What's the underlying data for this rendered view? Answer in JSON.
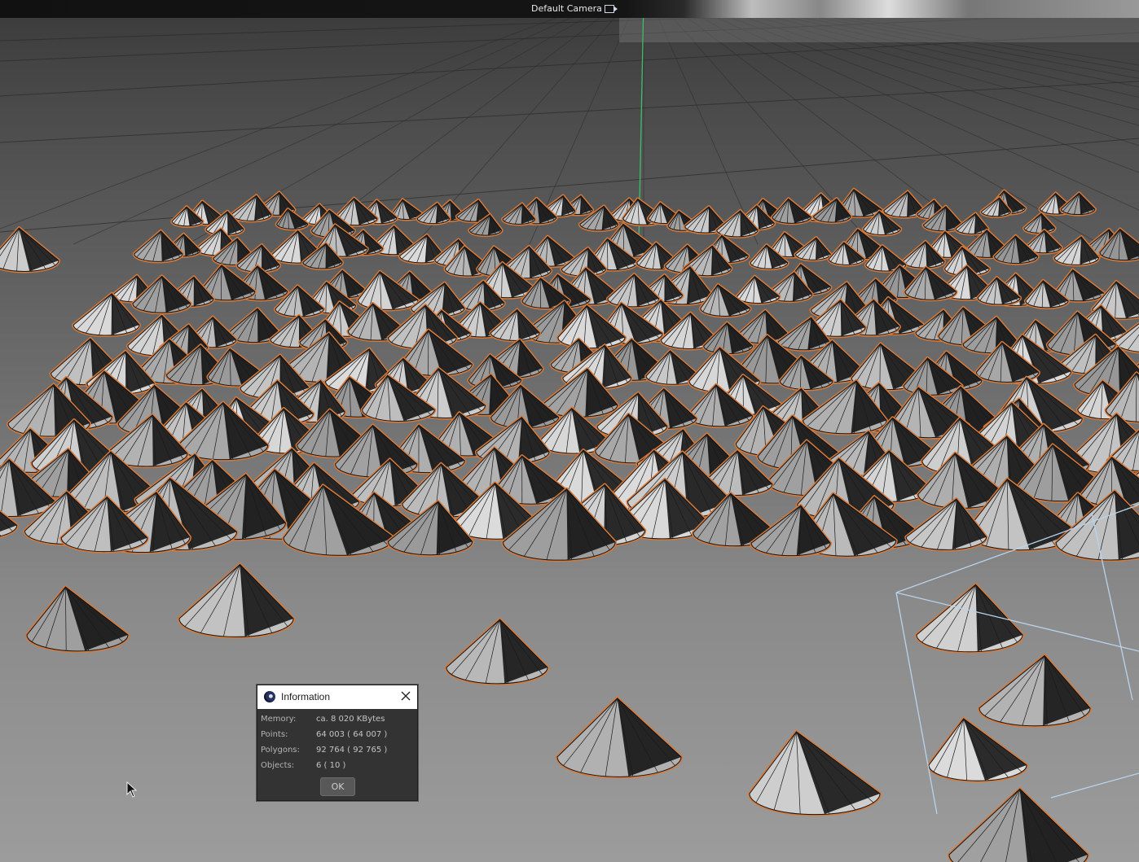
{
  "viewport": {
    "camera_label": "Default Camera",
    "camera_icon": "camera-icon"
  },
  "dialog": {
    "title": "Information",
    "logo_icon": "cinema4d-logo-icon",
    "close_icon": "close-icon",
    "rows": [
      {
        "label": "Memory:",
        "value": "ca. 8 020 KBytes"
      },
      {
        "label": "Points:",
        "value": "64 003 ( 64 007 )"
      },
      {
        "label": "Polygons:",
        "value": "92 764 ( 92 765 )"
      },
      {
        "label": "Objects:",
        "value": "6 ( 10 )"
      }
    ],
    "ok_label": "OK"
  },
  "colors": {
    "selection_outline": "#d77a3a",
    "y_axis": "#3cbf6a",
    "camera_frame": "#b9d3ec"
  }
}
